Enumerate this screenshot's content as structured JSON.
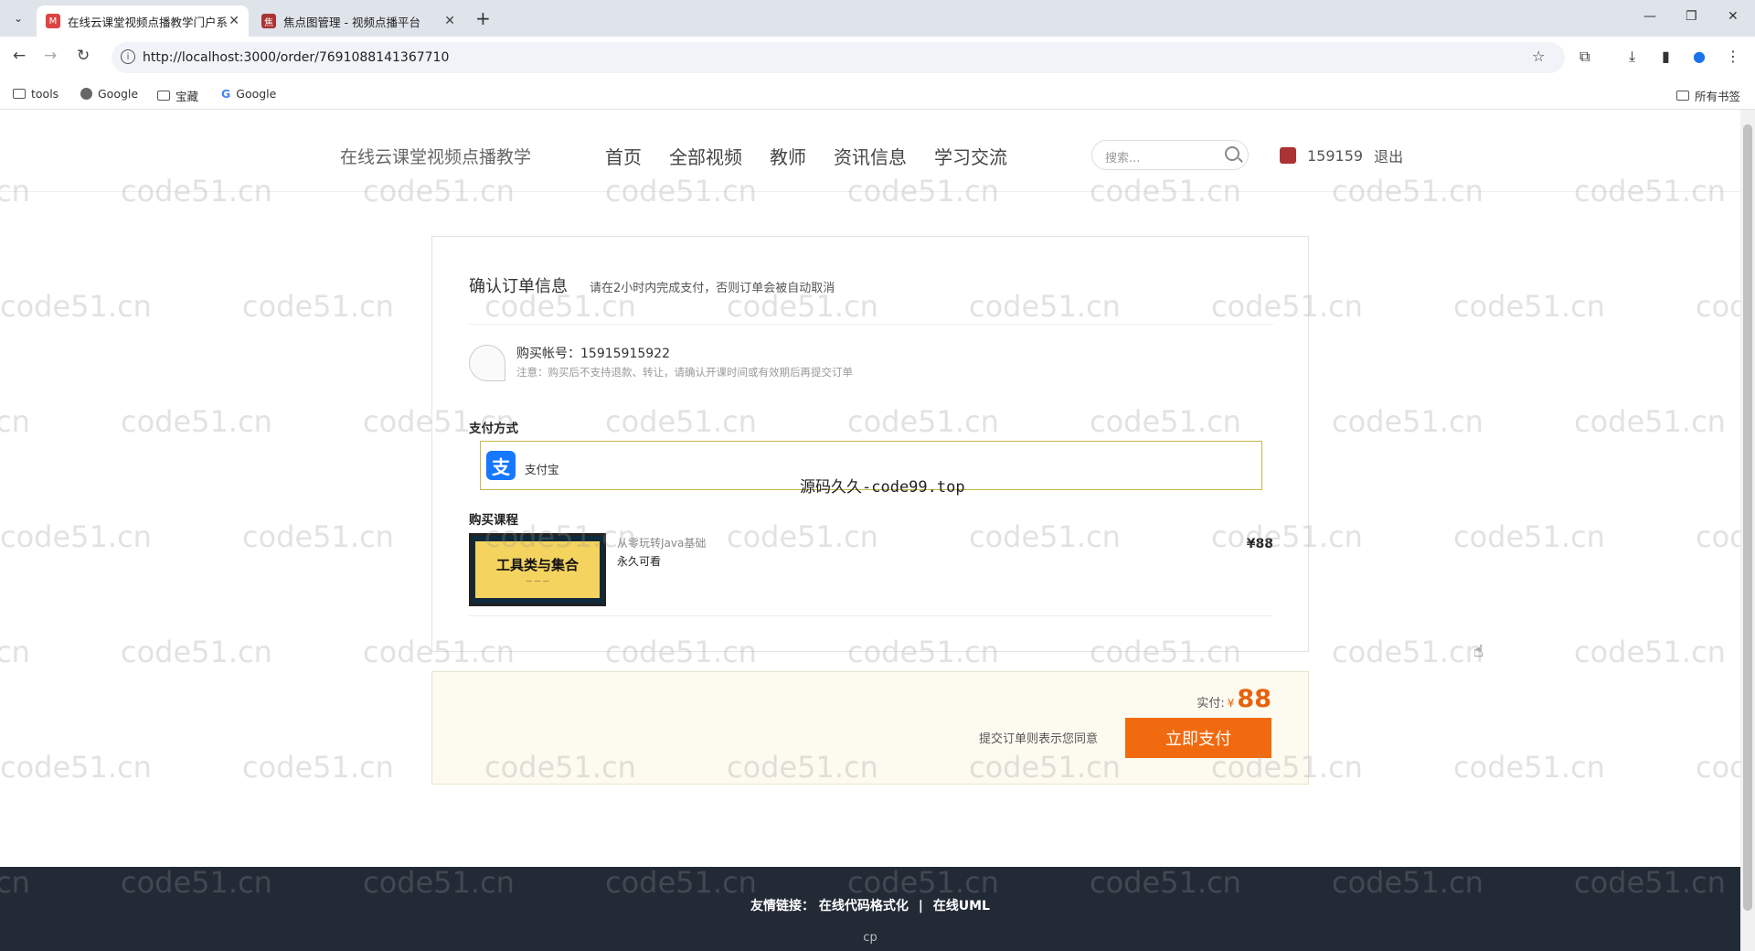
{
  "browser": {
    "tabs": [
      {
        "title": "在线云课堂视频点播教学门户系",
        "active": true
      },
      {
        "title": "焦点图管理 - 视频点播平台",
        "active": false
      }
    ],
    "url": "http://localhost:3000/order/7691088141367710",
    "bookmarks": [
      "tools",
      "Google",
      "宝藏",
      "Google"
    ],
    "all_bookmarks": "所有书签"
  },
  "header": {
    "site_title": "在线云课堂视频点播教学",
    "nav": [
      "首页",
      "全部视频",
      "教师",
      "资讯信息",
      "学习交流"
    ],
    "search_placeholder": "搜索...",
    "username": "159159",
    "logout": "退出"
  },
  "order": {
    "title": "确认订单信息",
    "tip": "请在2小时内完成支付，否则订单会被自动取消",
    "account_label": "购买帐号：15915915922",
    "note": "注意：购买后不支持退款、转让，请确认开课时间或有效期后再提交订单",
    "payment_label": "支付方式",
    "payment_method": "支付宝",
    "course_label": "购买课程",
    "course_image_text": "工具类与集合",
    "course_name": "从零玩转Java基础",
    "course_validity": "永久可看",
    "course_price": "¥88"
  },
  "pay": {
    "paid_label": "实付:",
    "currency": "¥",
    "amount": "88",
    "agree_text": "提交订单则表示您同意",
    "pay_button": "立即支付"
  },
  "overlay_text": "源码久久-code99.top",
  "watermark": "code51.cn",
  "footer": {
    "links_label": "友情链接：",
    "link1": "在线代码格式化",
    "separator": "|",
    "link2": "在线UML",
    "copyright": "cp"
  },
  "colors": {
    "accent": "#f26a10",
    "alipay": "#1677ff",
    "footer_bg": "#222a36"
  }
}
